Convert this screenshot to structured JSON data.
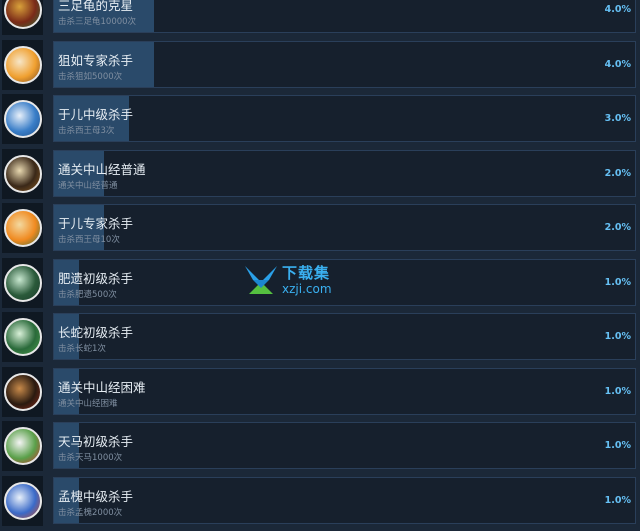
{
  "achievements": [
    {
      "title": "三足龟的克星",
      "desc": "击杀三足龟10000次",
      "percent": "4.0%",
      "fill": 4.0,
      "colors": [
        "#7a2a18",
        "#d9a13a",
        "#2f6b3a"
      ]
    },
    {
      "title": "狙如专家杀手",
      "desc": "击杀狙如5000次",
      "percent": "4.0%",
      "fill": 4.0,
      "colors": [
        "#f0a030",
        "#f6e6c8",
        "#7a4a20"
      ]
    },
    {
      "title": "于儿中级杀手",
      "desc": "击杀西王母3次",
      "percent": "3.0%",
      "fill": 3.0,
      "colors": [
        "#3a7ec8",
        "#e8f0fa",
        "#1e4f8a"
      ]
    },
    {
      "title": "通关中山经普通",
      "desc": "通关中山经普通",
      "percent": "2.0%",
      "fill": 2.0,
      "colors": [
        "#3a2818",
        "#e8d8b0",
        "#8a5a20"
      ]
    },
    {
      "title": "于儿专家杀手",
      "desc": "击杀西王母10次",
      "percent": "2.0%",
      "fill": 2.0,
      "colors": [
        "#f08a20",
        "#f3d9a0",
        "#3a6a3a"
      ]
    },
    {
      "title": "肥遗初级杀手",
      "desc": "击杀肥遗500次",
      "percent": "1.0%",
      "fill": 1.0,
      "colors": [
        "#2a5a3a",
        "#c8e8d0",
        "#1a3a2a"
      ]
    },
    {
      "title": "长蛇初级杀手",
      "desc": "击杀长蛇1次",
      "percent": "1.0%",
      "fill": 1.0,
      "colors": [
        "#2a6a3a",
        "#d8f0d8",
        "#4a9a4a"
      ]
    },
    {
      "title": "通关中山经困难",
      "desc": "通关中山经困难",
      "percent": "1.0%",
      "fill": 1.0,
      "colors": [
        "#2a1a10",
        "#c88a4a",
        "#8a2a1a"
      ]
    },
    {
      "title": "天马初级杀手",
      "desc": "击杀天马1000次",
      "percent": "1.0%",
      "fill": 1.0,
      "colors": [
        "#5aa04a",
        "#f4f4f4",
        "#c8302a"
      ]
    },
    {
      "title": "孟槐中级杀手",
      "desc": "击杀孟槐2000次",
      "percent": "1.0%",
      "fill": 1.0,
      "colors": [
        "#3a6ac8",
        "#e8f0fa",
        "#c84a2a"
      ]
    }
  ],
  "watermark": {
    "cn": "下载集",
    "en": "xzji.com"
  }
}
